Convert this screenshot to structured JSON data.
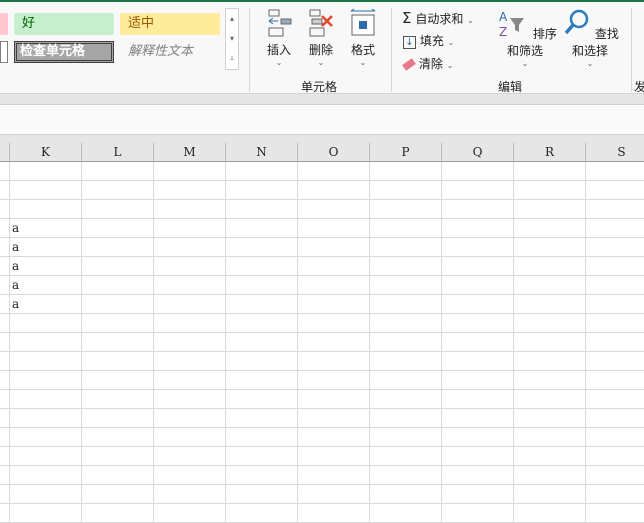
{
  "styles": {
    "good": "好",
    "neutral": "适中",
    "check_cell": "检查单元格",
    "explanatory": "解释性文本"
  },
  "cells_group": {
    "insert": "插入",
    "delete": "删除",
    "format": "格式",
    "label": "单元格"
  },
  "editing_group": {
    "autosum": "自动求和",
    "fill": "填充",
    "clear": "清除",
    "sort_filter": "排序和筛选",
    "find_select": "查找和选择",
    "label": "编辑"
  },
  "next_group_partial": "发",
  "columns": [
    "K",
    "L",
    "M",
    "N",
    "O",
    "P",
    "Q",
    "R",
    "S"
  ],
  "rows": [
    [
      "",
      "",
      "",
      "",
      "",
      "",
      "",
      "",
      ""
    ],
    [
      "",
      "",
      "",
      "",
      "",
      "",
      "",
      "",
      ""
    ],
    [
      "",
      "",
      "",
      "",
      "",
      "",
      "",
      "",
      ""
    ],
    [
      "a",
      "",
      "",
      "",
      "",
      "",
      "",
      "",
      ""
    ],
    [
      "a",
      "",
      "",
      "",
      "",
      "",
      "",
      "",
      ""
    ],
    [
      "a",
      "",
      "",
      "",
      "",
      "",
      "",
      "",
      ""
    ],
    [
      "a",
      "",
      "",
      "",
      "",
      "",
      "",
      "",
      ""
    ],
    [
      "a",
      "",
      "",
      "",
      "",
      "",
      "",
      "",
      ""
    ]
  ],
  "colors": {
    "accent": "#217346",
    "good_bg": "#c6efce",
    "good_fg": "#006100",
    "neutral_bg": "#ffeb9c",
    "neutral_fg": "#9c5700"
  }
}
